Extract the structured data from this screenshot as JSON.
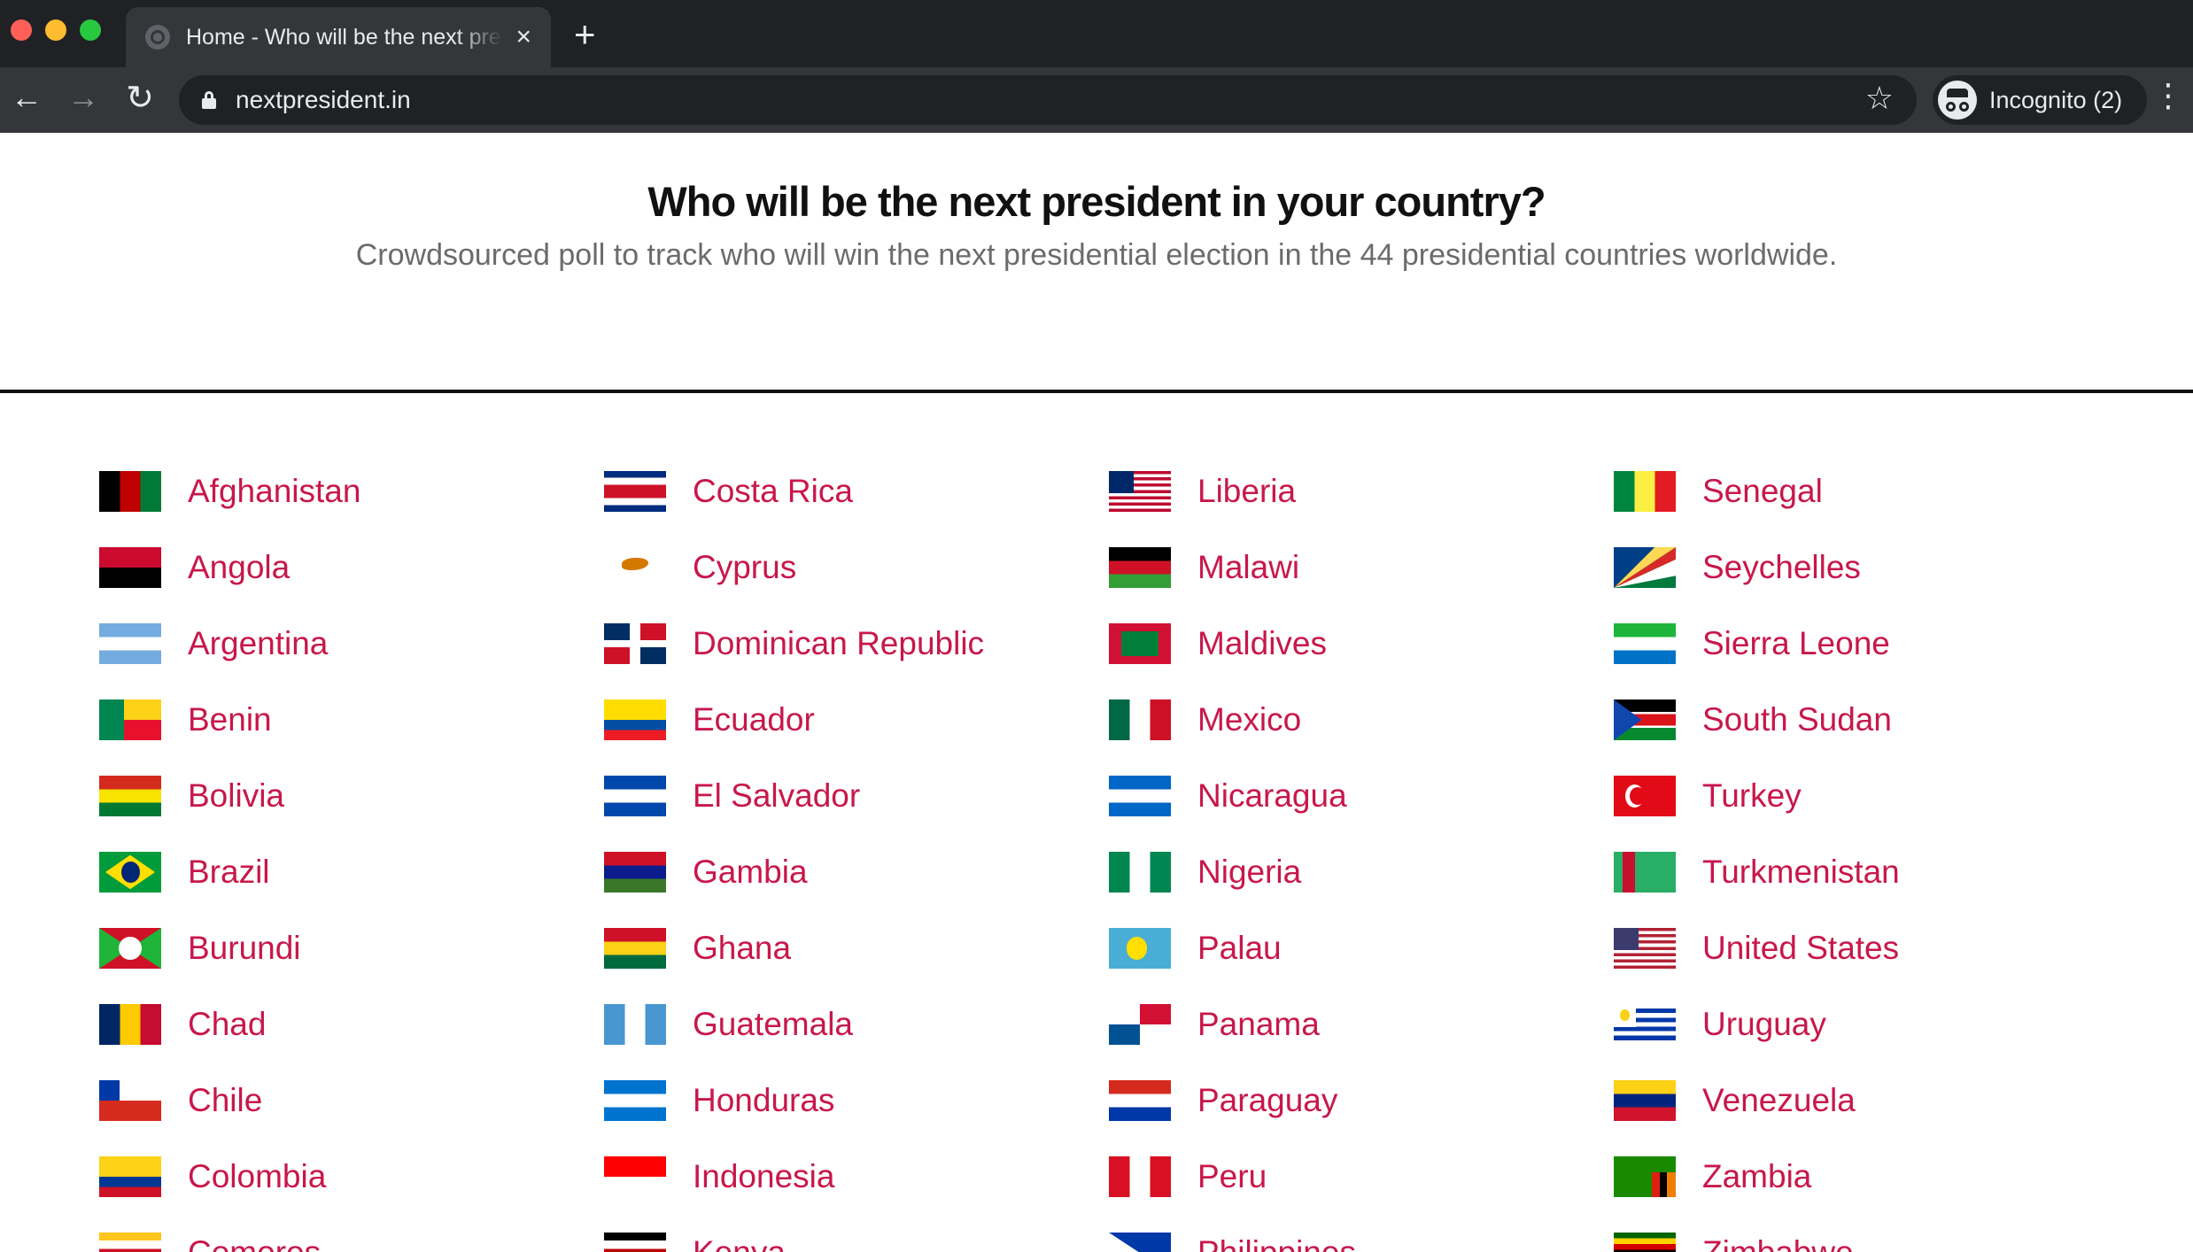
{
  "browser": {
    "tab_title": "Home - Who will be the next president in your country?",
    "url": "nextpresident.in",
    "incognito_label": "Incognito (2)"
  },
  "page": {
    "title": "Who will be the next president in your country?",
    "subtitle": "Crowdsourced poll to track who will win the next presidential election in the 44 presidential countries worldwide."
  },
  "columns": [
    [
      {
        "name": "Afghanistan",
        "colors": [
          "#000000",
          "#be0000",
          "#007a36"
        ],
        "dir": "v"
      },
      {
        "name": "Angola",
        "colors": [
          "#cc092f",
          "#000000"
        ],
        "dir": "h"
      },
      {
        "name": "Argentina",
        "colors": [
          "#74acdf",
          "#ffffff",
          "#74acdf"
        ],
        "dir": "h"
      },
      {
        "name": "Benin",
        "colors": [
          "#008751",
          "#fcd116",
          "#e8112d"
        ],
        "dir": "benin"
      },
      {
        "name": "Bolivia",
        "colors": [
          "#d52b1e",
          "#f9e300",
          "#007934"
        ],
        "dir": "h"
      },
      {
        "name": "Brazil",
        "colors": [
          "#009c3b",
          "#ffdf00",
          "#002776"
        ],
        "dir": "brazil"
      },
      {
        "name": "Burundi",
        "colors": [
          "#ce1126",
          "#1eb53a",
          "#ffffff"
        ],
        "dir": "burundi"
      },
      {
        "name": "Chad",
        "colors": [
          "#002664",
          "#fecb00",
          "#c60c30"
        ],
        "dir": "v"
      },
      {
        "name": "Chile",
        "colors": [
          "#ffffff",
          "#d52b1e",
          "#0039a6"
        ],
        "dir": "chile"
      },
      {
        "name": "Colombia",
        "colors": [
          "#fcd116",
          "#fcd116",
          "#003893",
          "#ce1126"
        ],
        "dir": "h"
      },
      {
        "name": "Comoros",
        "colors": [
          "#ffc61e",
          "#ffffff",
          "#ce1126",
          "#3a75c4",
          "#3d8e33"
        ],
        "dir": "h"
      }
    ],
    [
      {
        "name": "Costa Rica",
        "colors": [
          "#002b7f",
          "#ffffff",
          "#ce1126",
          "#ce1126",
          "#ffffff",
          "#002b7f"
        ],
        "dir": "h"
      },
      {
        "name": "Cyprus",
        "colors": [
          "#ffffff",
          "#d57800"
        ],
        "dir": "cyprus"
      },
      {
        "name": "Dominican Republic",
        "colors": [
          "#002d62",
          "#ce1126",
          "#ffffff"
        ],
        "dir": "dominican"
      },
      {
        "name": "Ecuador",
        "colors": [
          "#ffdd00",
          "#ffdd00",
          "#034ea2",
          "#ed1c24"
        ],
        "dir": "h"
      },
      {
        "name": "El Salvador",
        "colors": [
          "#0047ab",
          "#ffffff",
          "#0047ab"
        ],
        "dir": "h"
      },
      {
        "name": "Gambia",
        "colors": [
          "#ce1126",
          "#0c1c8c",
          "#3a7728"
        ],
        "dir": "h"
      },
      {
        "name": "Ghana",
        "colors": [
          "#ce1126",
          "#fcd116",
          "#006b3f"
        ],
        "dir": "h"
      },
      {
        "name": "Guatemala",
        "colors": [
          "#4997d0",
          "#ffffff",
          "#4997d0"
        ],
        "dir": "v"
      },
      {
        "name": "Honduras",
        "colors": [
          "#0073cf",
          "#ffffff",
          "#0073cf"
        ],
        "dir": "h"
      },
      {
        "name": "Indonesia",
        "colors": [
          "#ff0000",
          "#ffffff"
        ],
        "dir": "h"
      },
      {
        "name": "Kenya",
        "colors": [
          "#000000",
          "#ffffff",
          "#bb0000",
          "#ffffff",
          "#006600"
        ],
        "dir": "h"
      }
    ],
    [
      {
        "name": "Liberia",
        "colors": [
          "#bf0a30",
          "#ffffff",
          "#002868"
        ],
        "dir": "stripes"
      },
      {
        "name": "Malawi",
        "colors": [
          "#000000",
          "#ce1126",
          "#339e35"
        ],
        "dir": "h"
      },
      {
        "name": "Maldives",
        "colors": [
          "#d21034",
          "#007e3a"
        ],
        "dir": "maldives"
      },
      {
        "name": "Mexico",
        "colors": [
          "#006847",
          "#ffffff",
          "#ce1126"
        ],
        "dir": "v"
      },
      {
        "name": "Nicaragua",
        "colors": [
          "#0067c6",
          "#ffffff",
          "#0067c6"
        ],
        "dir": "h"
      },
      {
        "name": "Nigeria",
        "colors": [
          "#008751",
          "#ffffff",
          "#008751"
        ],
        "dir": "v"
      },
      {
        "name": "Palau",
        "colors": [
          "#4aadd6",
          "#ffde00"
        ],
        "dir": "palau"
      },
      {
        "name": "Panama",
        "colors": [
          "#ffffff",
          "#d21034",
          "#005293"
        ],
        "dir": "panama"
      },
      {
        "name": "Paraguay",
        "colors": [
          "#d52b1e",
          "#ffffff",
          "#0038a8"
        ],
        "dir": "h"
      },
      {
        "name": "Peru",
        "colors": [
          "#d91023",
          "#ffffff",
          "#d91023"
        ],
        "dir": "v"
      },
      {
        "name": "Philippines",
        "colors": [
          "#0038a8",
          "#ce1126",
          "#ffffff"
        ],
        "dir": "philippines"
      }
    ],
    [
      {
        "name": "Senegal",
        "colors": [
          "#00853f",
          "#fdef42",
          "#e31b23"
        ],
        "dir": "v"
      },
      {
        "name": "Seychelles",
        "colors": [
          "#003f87",
          "#fcd856",
          "#d62828",
          "#ffffff",
          "#007a3d"
        ],
        "dir": "seychelles"
      },
      {
        "name": "Sierra Leone",
        "colors": [
          "#1eb53a",
          "#ffffff",
          "#0072c6"
        ],
        "dir": "h"
      },
      {
        "name": "South Sudan",
        "colors": [
          "#000000",
          "#ffffff",
          "#da121a",
          "#ffffff",
          "#078930"
        ],
        "dir": "ssudan"
      },
      {
        "name": "Turkey",
        "colors": [
          "#e30a17"
        ],
        "dir": "turkey"
      },
      {
        "name": "Turkmenistan",
        "colors": [
          "#28ae66",
          "#c8102e"
        ],
        "dir": "turkmen"
      },
      {
        "name": "United States",
        "colors": [
          "#b22234",
          "#ffffff",
          "#3c3b6e"
        ],
        "dir": "stripes"
      },
      {
        "name": "Uruguay",
        "colors": [
          "#0038a8",
          "#ffffff"
        ],
        "dir": "uruguay"
      },
      {
        "name": "Venezuela",
        "colors": [
          "#fcd116",
          "#00247d",
          "#cf142b"
        ],
        "dir": "h"
      },
      {
        "name": "Zambia",
        "colors": [
          "#198a00",
          "#de2010",
          "#000000",
          "#ef7d00"
        ],
        "dir": "zambia"
      },
      {
        "name": "Zimbabwe",
        "colors": [
          "#006400",
          "#ffd200",
          "#d40000",
          "#000000",
          "#d40000",
          "#ffd200",
          "#006400"
        ],
        "dir": "h"
      }
    ]
  ]
}
